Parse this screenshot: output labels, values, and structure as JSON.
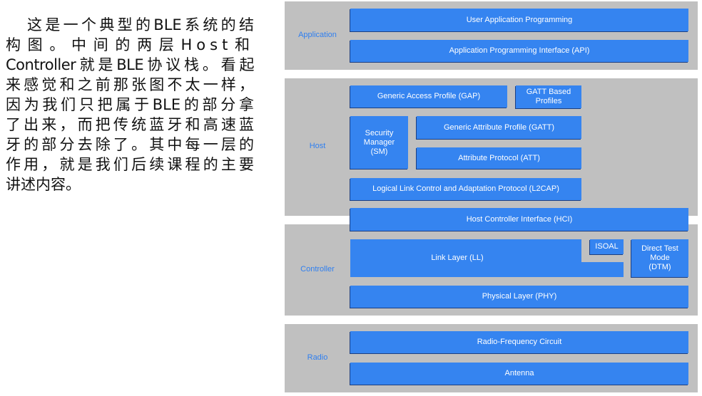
{
  "text_lines": [
    "这是一个典型的BLE系统的结",
    "构图。中间的两层Host和",
    "Controller就是BLE协议栈。看起",
    "来感觉和之前那张图不太一样，",
    "因为我们只把属于BLE的部分拿",
    "了出来，而把传统蓝牙和高速蓝",
    "牙的部分去除了。其中每一层的",
    "作用，就是我们后续课程的主要",
    "讲述内容。"
  ],
  "diagram": {
    "layers": {
      "application": "Application",
      "host": "Host",
      "controller": "Controller",
      "radio": "Radio"
    },
    "blocks": {
      "user_app": "User Application Programming",
      "api": "Application Programming Interface (API)",
      "gap": "Generic Access Profile (GAP)",
      "gatt_profiles": "GATT Based Profiles",
      "sm": "Security Manager (SM)",
      "gatt": "Generic Attribute Profile (GATT)",
      "att": "Attribute Protocol (ATT)",
      "l2cap": "Logical Link Control and Adaptation Protocol (L2CAP)",
      "hci": "Host Controller Interface (HCI)",
      "ll": "Link Layer (LL)",
      "isoal": "ISOAL",
      "dtm": "Direct Test Mode (DTM)",
      "phy": "Physical Layer (PHY)",
      "rf": "Radio-Frequency Circuit",
      "antenna": "Antenna"
    },
    "colors": {
      "block": "#3584f0",
      "panel": "#c0c0c0",
      "label": "#2f7ff0"
    }
  }
}
